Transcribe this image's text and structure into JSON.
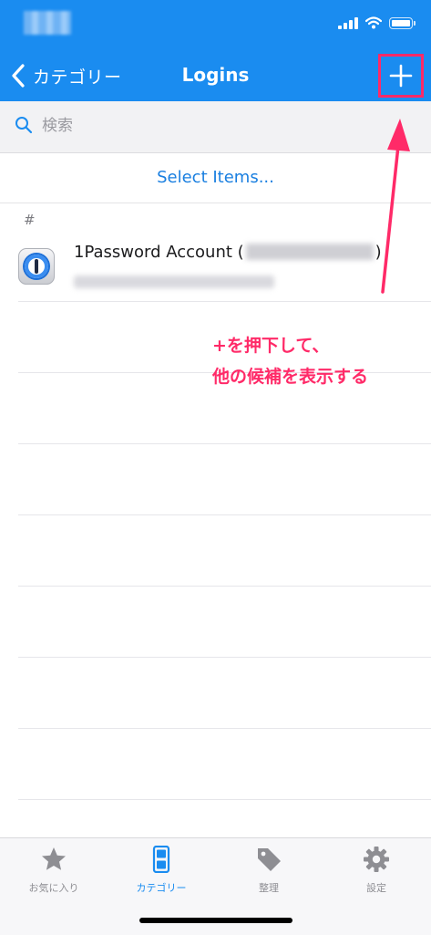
{
  "colors": {
    "accent": "#1a8cf0",
    "annotation": "#ff2a68",
    "tab_inactive": "#8e8e93"
  },
  "nav": {
    "back_label": "カテゴリー",
    "title": "Logins",
    "add_icon": "plus-icon"
  },
  "search": {
    "placeholder": "検索",
    "value": ""
  },
  "select_items_label": "Select Items...",
  "section_header": "#",
  "items": [
    {
      "icon": "1password-icon",
      "title_prefix": "1Password Account (",
      "title_suffix": ")"
    }
  ],
  "annotation": {
    "line1": "+を押下して、",
    "line2": "他の候補を表示する"
  },
  "tabs": [
    {
      "label": "お気に入り",
      "icon": "star-icon",
      "active": false
    },
    {
      "label": "カテゴリー",
      "icon": "category-cabinet-icon",
      "active": true
    },
    {
      "label": "整理",
      "icon": "tag-icon",
      "active": false
    },
    {
      "label": "設定",
      "icon": "gear-icon",
      "active": false
    }
  ]
}
